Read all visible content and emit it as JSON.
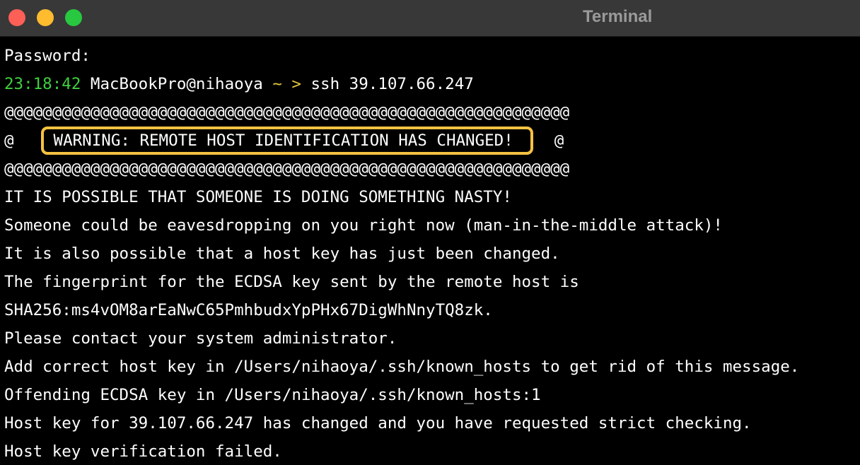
{
  "window": {
    "title": "Terminal",
    "colors": {
      "close": "#fe5f57",
      "minimize": "#febc2e",
      "zoom": "#28c840",
      "prompt_time": "#3fd03f",
      "prompt_arrow": "#e4c83c",
      "highlight_box": "#f5c242"
    }
  },
  "terminal": {
    "password_prompt": "Password:",
    "prompt": {
      "time": "23:18:42",
      "user_host": "MacBookPro@nihaoya",
      "path_arrow": "~ >",
      "command": "ssh 39.107.66.247"
    },
    "border_line": "@@@@@@@@@@@@@@@@@@@@@@@@@@@@@@@@@@@@@@@@@@@@@@@@@@@@@@@@@@@",
    "warning_at": "@",
    "warning_text": "WARNING: REMOTE HOST IDENTIFICATION HAS CHANGED!",
    "lines": [
      "IT IS POSSIBLE THAT SOMEONE IS DOING SOMETHING NASTY!",
      "Someone could be eavesdropping on you right now (man-in-the-middle attack)!",
      "It is also possible that a host key has just been changed.",
      "The fingerprint for the ECDSA key sent by the remote host is",
      "SHA256:ms4vOM8arEaNwC65PmhbudxYpPHx67DigWhNnyTQ8zk.",
      "Please contact your system administrator.",
      "Add correct host key in /Users/nihaoya/.ssh/known_hosts to get rid of this message.",
      "Offending ECDSA key in /Users/nihaoya/.ssh/known_hosts:1",
      "Host key for 39.107.66.247 has changed and you have requested strict checking.",
      "Host key verification failed."
    ]
  }
}
